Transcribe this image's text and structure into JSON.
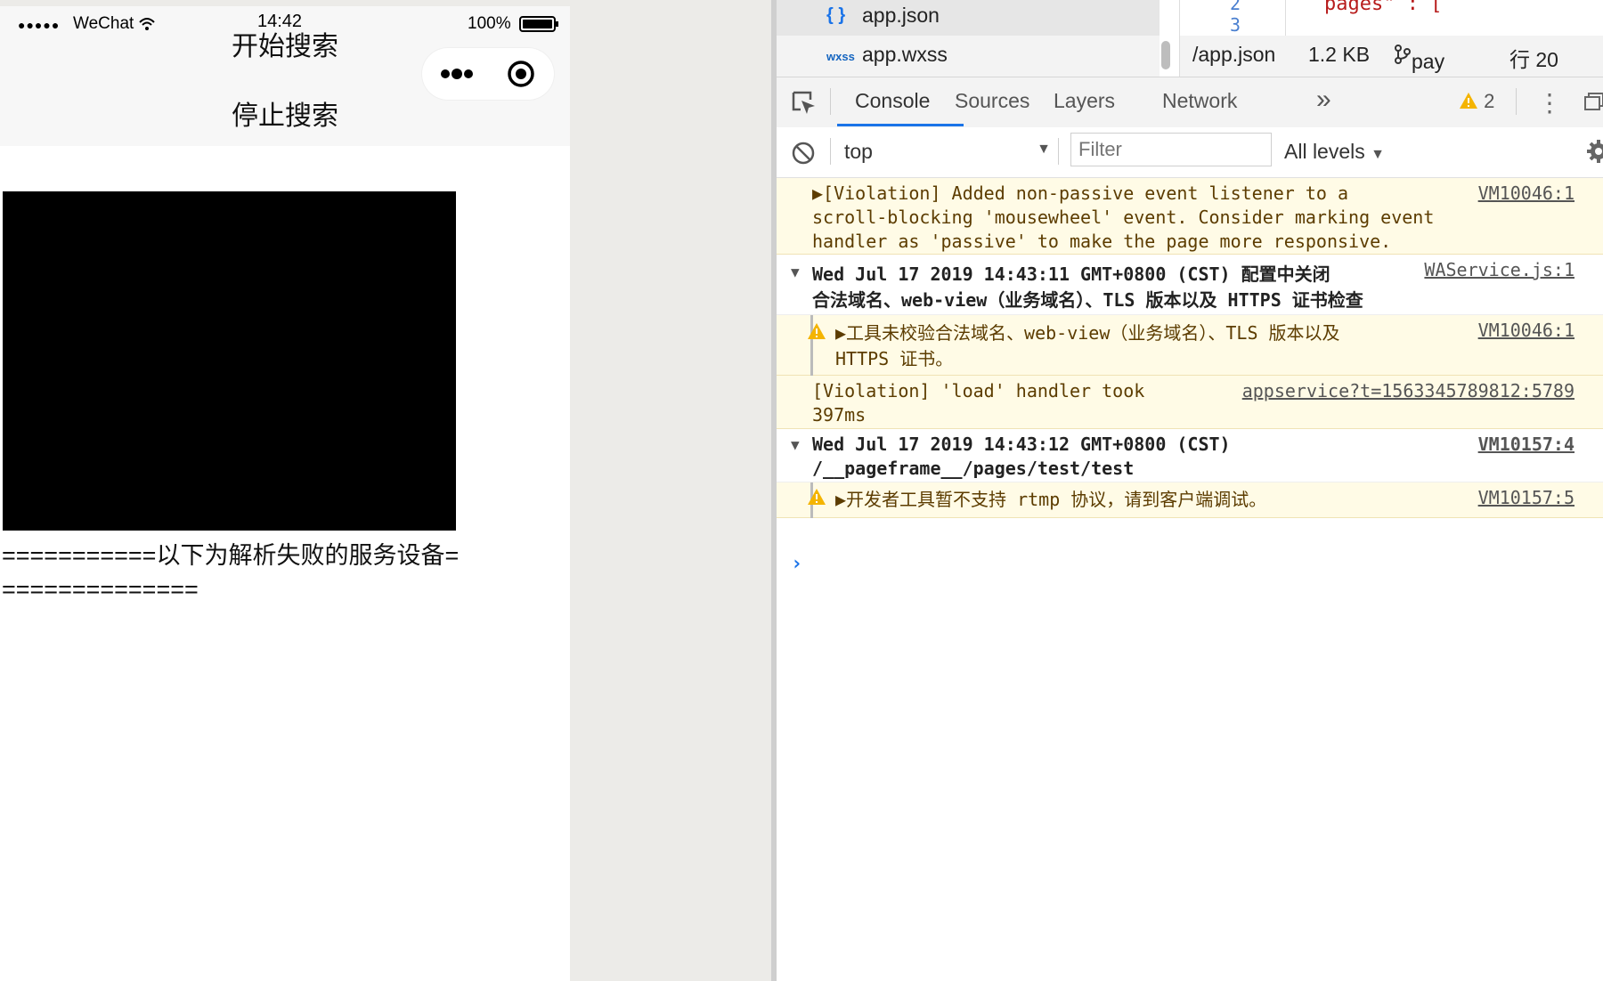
{
  "simulator": {
    "status_bar": {
      "signal": "●●●●●",
      "carrier": "WeChat",
      "time": "14:42",
      "battery_pct": "100%"
    },
    "buttons": {
      "start": "开始搜索",
      "stop": "停止搜索"
    },
    "fail_text": "===========以下为解析失败的服务设备===============",
    "icons": [
      "signal-icon",
      "wifi-icon",
      "battery-icon",
      "more-icon",
      "record-icon"
    ]
  },
  "devtools": {
    "files": [
      {
        "icon": "{ }",
        "name": "app.json"
      },
      {
        "icon": "wxss",
        "name": "app.wxss"
      }
    ],
    "editor": {
      "line_numbers": [
        "2",
        "3"
      ],
      "code": "pages\" : ["
    },
    "file_status": {
      "path": "/app.json",
      "size": "1.2 KB",
      "branch": "pay",
      "line": "行 20"
    },
    "tabs": [
      "Console",
      "Sources",
      "Layers",
      "Network"
    ],
    "active_tab": "Console",
    "more_tabs": "»",
    "warning_count": "2",
    "filter": {
      "context": "top",
      "placeholder": "Filter",
      "levels": "All levels"
    },
    "accent_color": "#1a73e8",
    "warning_bg": "#fffbe6"
  },
  "console": {
    "messages": [
      {
        "text": "▶[Violation] Added non-passive event listener to a\nscroll-blocking 'mousewheel' event. Consider marking event\nhandler as 'passive' to make the page more responsive.",
        "source": "VM10046:1"
      },
      {
        "text": "Wed Jul 17 2019 14:43:11 GMT+0800 (CST) 配置中关闭\n合法域名、web-view（业务域名）、TLS 版本以及 HTTPS 证书检查",
        "source": "WAService.js:1"
      },
      {
        "text": "▶工具未校验合法域名、web-view（业务域名）、TLS 版本以及\nHTTPS 证书。",
        "source": "VM10046:1"
      },
      {
        "text": "[Violation] 'load' handler took\n397ms",
        "source": "appservice?t=1563345789812:5789"
      },
      {
        "text": "Wed Jul 17 2019 14:43:12 GMT+0800 (CST)\n/__pageframe__/pages/test/test",
        "source": "VM10157:4"
      },
      {
        "text": "▶开发者工具暂不支持 rtmp 协议，请到客户端调试。",
        "source": "VM10157:5"
      }
    ],
    "prompt": "›"
  }
}
